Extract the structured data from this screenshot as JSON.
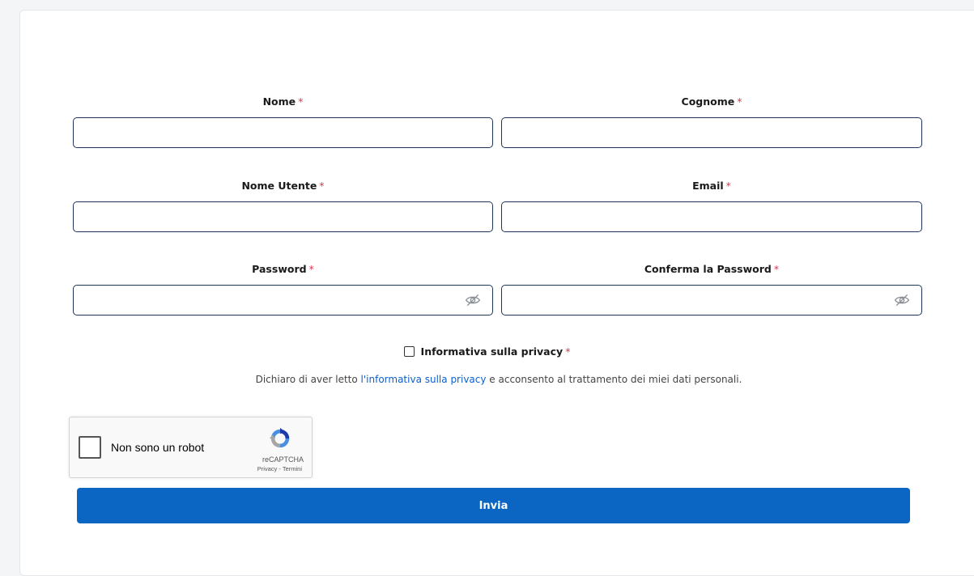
{
  "form": {
    "required_mark": "*",
    "fields": {
      "nome": {
        "label": "Nome",
        "value": "",
        "placeholder": ""
      },
      "cognome": {
        "label": "Cognome",
        "value": "",
        "placeholder": ""
      },
      "nome_utente": {
        "label": "Nome Utente",
        "value": "",
        "placeholder": ""
      },
      "email": {
        "label": "Email",
        "value": "",
        "placeholder": ""
      },
      "password": {
        "label": "Password",
        "value": "",
        "placeholder": ""
      },
      "conferma_password": {
        "label": "Conferma la Password",
        "value": "",
        "placeholder": ""
      }
    },
    "privacy": {
      "checkbox_label": "Informativa sulla privacy",
      "desc_before": "Dichiaro di aver letto ",
      "desc_link": "l'informativa sulla privacy",
      "desc_after": " e acconsento al trattamento dei miei dati personali."
    },
    "recaptcha": {
      "label": "Non sono un robot",
      "brand": "reCAPTCHA",
      "privacy_link": "Privacy",
      "separator": " - ",
      "terms_link": "Termini"
    },
    "submit_label": "Invia"
  },
  "icons": {
    "password_toggle": "eye-slash-icon",
    "recaptcha_logo": "recaptcha-logo-icon"
  },
  "colors": {
    "accent": "#0a66c2",
    "required": "#d9364f",
    "input_border": "#1d3557",
    "link": "#0b5fcc"
  }
}
